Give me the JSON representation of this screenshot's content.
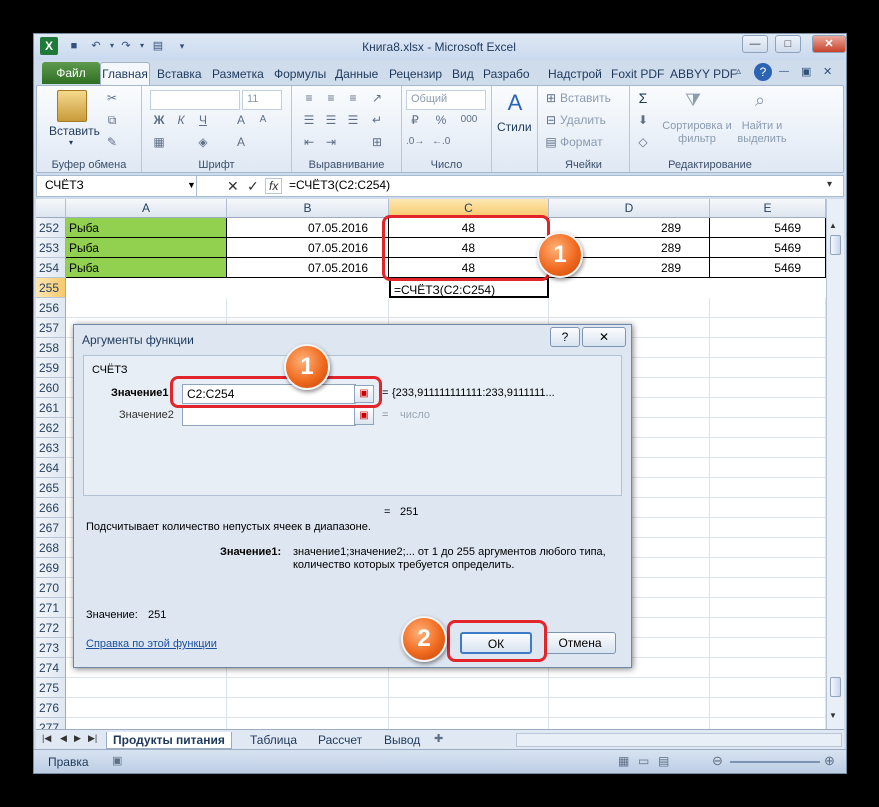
{
  "window": {
    "title": "Книга8.xlsx - Microsoft Excel",
    "min_label": "—",
    "max_label": "□",
    "close_label": "✕",
    "help_label": "?"
  },
  "tabs": [
    "Файл",
    "Главная",
    "Вставка",
    "Разметка",
    "Формулы",
    "Данные",
    "Рецензир",
    "Вид",
    "Разрабо",
    "Надстрой",
    "Foxit PDF",
    "ABBYY PDF"
  ],
  "ribbon": {
    "groups": {
      "clipboard": "Буфер обмена",
      "font": "Шрифт",
      "alignment": "Выравнивание",
      "number": "Число",
      "cells": "Ячейки",
      "editing": "Редактирование"
    },
    "paste_label": "Вставить",
    "font_size": "11",
    "number_format": "Общий",
    "styles_label": "Стили",
    "insert_label": "Вставить",
    "delete_label": "Удалить",
    "format_label": "Формат",
    "sort_label": "Сортировка и фильтр",
    "find_label": "Найти и выделить",
    "bold": "Ж",
    "italic": "К",
    "underline": "Ч",
    "percent": "%",
    "thousands": "000",
    "sum": "Σ"
  },
  "formula_bar": {
    "name_box": "СЧЁТЗ",
    "fx": "fx",
    "formula": "=СЧЁТЗ(C2:C254)"
  },
  "grid": {
    "columns": [
      "A",
      "B",
      "C",
      "D",
      "E"
    ],
    "rows": [
      {
        "num": "252",
        "a": "Рыба",
        "b": "07.05.2016",
        "c": "48",
        "d": "289",
        "e": "5469"
      },
      {
        "num": "253",
        "a": "Рыба",
        "b": "07.05.2016",
        "c": "48",
        "d": "289",
        "e": "5469"
      },
      {
        "num": "254",
        "a": "Рыба",
        "b": "07.05.2016",
        "c": "48",
        "d": "289",
        "e": "5469"
      },
      {
        "num": "255",
        "a": "",
        "b": "",
        "c": "=СЧЁТЗ(C2:C254)",
        "d": "",
        "e": ""
      }
    ],
    "extra_rows": [
      "256",
      "257",
      "258",
      "259",
      "260",
      "261",
      "262",
      "263",
      "264",
      "265",
      "266",
      "267",
      "268",
      "269",
      "270",
      "271",
      "272",
      "273",
      "274",
      "275",
      "276",
      "277"
    ]
  },
  "sheets": [
    "Продукты питания",
    "Таблица",
    "Рассчет",
    "Вывод"
  ],
  "status": {
    "mode": "Правка"
  },
  "dialog": {
    "title": "Аргументы функции",
    "help_label": "?",
    "close_label": "✕",
    "function_name": "СЧЁТЗ",
    "arg1_label": "Значение1",
    "arg1_value": "C2:C254",
    "arg1_result": "{233,911111111111:233,9111111...",
    "arg2_label": "Значение2",
    "arg2_placeholder": "число",
    "equals": "=",
    "total_result": "251",
    "description": "Подсчитывает количество непустых ячеек в диапазоне.",
    "arg_help_label": "Значение1:",
    "arg_help_text1": "значение1;значение2;... от 1 до 255 аргументов любого типа,",
    "arg_help_text2": "количество которых требуется определить.",
    "value_label": "Значение:",
    "value_result": "251",
    "help_link": "Справка по этой функции",
    "ok_label": "ОК",
    "cancel_label": "Отмена"
  },
  "annotations": {
    "badge1": "1",
    "badge2": "1",
    "badge3": "2"
  },
  "colors": {
    "annotation_red": "#e2242b",
    "badge_orange": "#f06a1f",
    "cell_green": "#92d050",
    "selected_col": "#f9d68c"
  }
}
